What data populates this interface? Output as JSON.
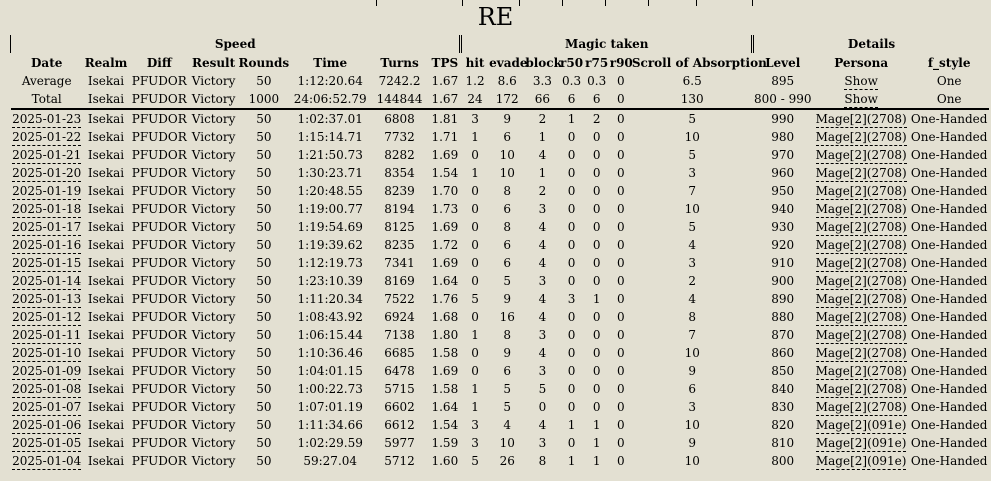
{
  "title": "RE",
  "groups": {
    "speed": "Speed",
    "magic": "Magic taken",
    "details": "Details"
  },
  "columns": [
    "Date",
    "Realm",
    "Diff",
    "Result",
    "Rounds",
    "Time",
    "Turns",
    "TPS",
    "hit",
    "evade",
    "block",
    "r50",
    "r75",
    "r90",
    "Scroll of Absorption",
    "Level",
    "Persona",
    "f_style"
  ],
  "summary": [
    {
      "label": "Average",
      "realm": "Isekai",
      "diff": "PFUDOR",
      "result": "Victory",
      "rounds": "50",
      "time": "1:12:20.64",
      "turns": "7242.2",
      "tps": "1.67",
      "hit": "1.2",
      "evade": "8.6",
      "block": "3.3",
      "r50": "0.3",
      "r75": "0.3",
      "r90": "0",
      "scroll": "6.5",
      "level": "895",
      "persona": "Show",
      "fstyle": "One"
    },
    {
      "label": "Total",
      "realm": "Isekai",
      "diff": "PFUDOR",
      "result": "Victory",
      "rounds": "1000",
      "time": "24:06:52.79",
      "turns": "144844",
      "tps": "1.67",
      "hit": "24",
      "evade": "172",
      "block": "66",
      "r50": "6",
      "r75": "6",
      "r90": "0",
      "scroll": "130",
      "level": "800 - 990",
      "persona": "Show",
      "fstyle": "One"
    }
  ],
  "rows": [
    {
      "date": "2025-01-23",
      "realm": "Isekai",
      "diff": "PFUDOR",
      "result": "Victory",
      "rounds": "50",
      "time": "1:02:37.01",
      "turns": "6808",
      "tps": "1.81",
      "hit": "3",
      "evade": "9",
      "block": "2",
      "r50": "1",
      "r75": "2",
      "r90": "0",
      "scroll": "5",
      "level": "990",
      "persona": "Mage[2](2708)",
      "fstyle": "One-Handed"
    },
    {
      "date": "2025-01-22",
      "realm": "Isekai",
      "diff": "PFUDOR",
      "result": "Victory",
      "rounds": "50",
      "time": "1:15:14.71",
      "turns": "7732",
      "tps": "1.71",
      "hit": "1",
      "evade": "6",
      "block": "1",
      "r50": "0",
      "r75": "0",
      "r90": "0",
      "scroll": "10",
      "level": "980",
      "persona": "Mage[2](2708)",
      "fstyle": "One-Handed"
    },
    {
      "date": "2025-01-21",
      "realm": "Isekai",
      "diff": "PFUDOR",
      "result": "Victory",
      "rounds": "50",
      "time": "1:21:50.73",
      "turns": "8282",
      "tps": "1.69",
      "hit": "0",
      "evade": "10",
      "block": "4",
      "r50": "0",
      "r75": "0",
      "r90": "0",
      "scroll": "5",
      "level": "970",
      "persona": "Mage[2](2708)",
      "fstyle": "One-Handed"
    },
    {
      "date": "2025-01-20",
      "realm": "Isekai",
      "diff": "PFUDOR",
      "result": "Victory",
      "rounds": "50",
      "time": "1:30:23.71",
      "turns": "8354",
      "tps": "1.54",
      "hit": "1",
      "evade": "10",
      "block": "1",
      "r50": "0",
      "r75": "0",
      "r90": "0",
      "scroll": "3",
      "level": "960",
      "persona": "Mage[2](2708)",
      "fstyle": "One-Handed"
    },
    {
      "date": "2025-01-19",
      "realm": "Isekai",
      "diff": "PFUDOR",
      "result": "Victory",
      "rounds": "50",
      "time": "1:20:48.55",
      "turns": "8239",
      "tps": "1.70",
      "hit": "0",
      "evade": "8",
      "block": "2",
      "r50": "0",
      "r75": "0",
      "r90": "0",
      "scroll": "7",
      "level": "950",
      "persona": "Mage[2](2708)",
      "fstyle": "One-Handed"
    },
    {
      "date": "2025-01-18",
      "realm": "Isekai",
      "diff": "PFUDOR",
      "result": "Victory",
      "rounds": "50",
      "time": "1:19:00.77",
      "turns": "8194",
      "tps": "1.73",
      "hit": "0",
      "evade": "6",
      "block": "3",
      "r50": "0",
      "r75": "0",
      "r90": "0",
      "scroll": "10",
      "level": "940",
      "persona": "Mage[2](2708)",
      "fstyle": "One-Handed"
    },
    {
      "date": "2025-01-17",
      "realm": "Isekai",
      "diff": "PFUDOR",
      "result": "Victory",
      "rounds": "50",
      "time": "1:19:54.69",
      "turns": "8125",
      "tps": "1.69",
      "hit": "0",
      "evade": "8",
      "block": "4",
      "r50": "0",
      "r75": "0",
      "r90": "0",
      "scroll": "5",
      "level": "930",
      "persona": "Mage[2](2708)",
      "fstyle": "One-Handed"
    },
    {
      "date": "2025-01-16",
      "realm": "Isekai",
      "diff": "PFUDOR",
      "result": "Victory",
      "rounds": "50",
      "time": "1:19:39.62",
      "turns": "8235",
      "tps": "1.72",
      "hit": "0",
      "evade": "6",
      "block": "4",
      "r50": "0",
      "r75": "0",
      "r90": "0",
      "scroll": "4",
      "level": "920",
      "persona": "Mage[2](2708)",
      "fstyle": "One-Handed"
    },
    {
      "date": "2025-01-15",
      "realm": "Isekai",
      "diff": "PFUDOR",
      "result": "Victory",
      "rounds": "50",
      "time": "1:12:19.73",
      "turns": "7341",
      "tps": "1.69",
      "hit": "0",
      "evade": "6",
      "block": "4",
      "r50": "0",
      "r75": "0",
      "r90": "0",
      "scroll": "3",
      "level": "910",
      "persona": "Mage[2](2708)",
      "fstyle": "One-Handed"
    },
    {
      "date": "2025-01-14",
      "realm": "Isekai",
      "diff": "PFUDOR",
      "result": "Victory",
      "rounds": "50",
      "time": "1:23:10.39",
      "turns": "8169",
      "tps": "1.64",
      "hit": "0",
      "evade": "5",
      "block": "3",
      "r50": "0",
      "r75": "0",
      "r90": "0",
      "scroll": "2",
      "level": "900",
      "persona": "Mage[2](2708)",
      "fstyle": "One-Handed"
    },
    {
      "date": "2025-01-13",
      "realm": "Isekai",
      "diff": "PFUDOR",
      "result": "Victory",
      "rounds": "50",
      "time": "1:11:20.34",
      "turns": "7522",
      "tps": "1.76",
      "hit": "5",
      "evade": "9",
      "block": "4",
      "r50": "3",
      "r75": "1",
      "r90": "0",
      "scroll": "4",
      "level": "890",
      "persona": "Mage[2](2708)",
      "fstyle": "One-Handed"
    },
    {
      "date": "2025-01-12",
      "realm": "Isekai",
      "diff": "PFUDOR",
      "result": "Victory",
      "rounds": "50",
      "time": "1:08:43.92",
      "turns": "6924",
      "tps": "1.68",
      "hit": "0",
      "evade": "16",
      "block": "4",
      "r50": "0",
      "r75": "0",
      "r90": "0",
      "scroll": "8",
      "level": "880",
      "persona": "Mage[2](2708)",
      "fstyle": "One-Handed"
    },
    {
      "date": "2025-01-11",
      "realm": "Isekai",
      "diff": "PFUDOR",
      "result": "Victory",
      "rounds": "50",
      "time": "1:06:15.44",
      "turns": "7138",
      "tps": "1.80",
      "hit": "1",
      "evade": "8",
      "block": "3",
      "r50": "0",
      "r75": "0",
      "r90": "0",
      "scroll": "7",
      "level": "870",
      "persona": "Mage[2](2708)",
      "fstyle": "One-Handed"
    },
    {
      "date": "2025-01-10",
      "realm": "Isekai",
      "diff": "PFUDOR",
      "result": "Victory",
      "rounds": "50",
      "time": "1:10:36.46",
      "turns": "6685",
      "tps": "1.58",
      "hit": "0",
      "evade": "9",
      "block": "4",
      "r50": "0",
      "r75": "0",
      "r90": "0",
      "scroll": "10",
      "level": "860",
      "persona": "Mage[2](2708)",
      "fstyle": "One-Handed"
    },
    {
      "date": "2025-01-09",
      "realm": "Isekai",
      "diff": "PFUDOR",
      "result": "Victory",
      "rounds": "50",
      "time": "1:04:01.15",
      "turns": "6478",
      "tps": "1.69",
      "hit": "0",
      "evade": "6",
      "block": "3",
      "r50": "0",
      "r75": "0",
      "r90": "0",
      "scroll": "9",
      "level": "850",
      "persona": "Mage[2](2708)",
      "fstyle": "One-Handed"
    },
    {
      "date": "2025-01-08",
      "realm": "Isekai",
      "diff": "PFUDOR",
      "result": "Victory",
      "rounds": "50",
      "time": "1:00:22.73",
      "turns": "5715",
      "tps": "1.58",
      "hit": "1",
      "evade": "5",
      "block": "5",
      "r50": "0",
      "r75": "0",
      "r90": "0",
      "scroll": "6",
      "level": "840",
      "persona": "Mage[2](2708)",
      "fstyle": "One-Handed"
    },
    {
      "date": "2025-01-07",
      "realm": "Isekai",
      "diff": "PFUDOR",
      "result": "Victory",
      "rounds": "50",
      "time": "1:07:01.19",
      "turns": "6602",
      "tps": "1.64",
      "hit": "1",
      "evade": "5",
      "block": "0",
      "r50": "0",
      "r75": "0",
      "r90": "0",
      "scroll": "3",
      "level": "830",
      "persona": "Mage[2](2708)",
      "fstyle": "One-Handed"
    },
    {
      "date": "2025-01-06",
      "realm": "Isekai",
      "diff": "PFUDOR",
      "result": "Victory",
      "rounds": "50",
      "time": "1:11:34.66",
      "turns": "6612",
      "tps": "1.54",
      "hit": "3",
      "evade": "4",
      "block": "4",
      "r50": "1",
      "r75": "1",
      "r90": "0",
      "scroll": "10",
      "level": "820",
      "persona": "Mage[2](091e)",
      "fstyle": "One-Handed"
    },
    {
      "date": "2025-01-05",
      "realm": "Isekai",
      "diff": "PFUDOR",
      "result": "Victory",
      "rounds": "50",
      "time": "1:02:29.59",
      "turns": "5977",
      "tps": "1.59",
      "hit": "3",
      "evade": "10",
      "block": "3",
      "r50": "0",
      "r75": "1",
      "r90": "0",
      "scroll": "9",
      "level": "810",
      "persona": "Mage[2](091e)",
      "fstyle": "One-Handed"
    },
    {
      "date": "2025-01-04",
      "realm": "Isekai",
      "diff": "PFUDOR",
      "result": "Victory",
      "rounds": "50",
      "time": "59:27.04",
      "turns": "5712",
      "tps": "1.60",
      "hit": "5",
      "evade": "26",
      "block": "8",
      "r50": "1",
      "r75": "1",
      "r90": "0",
      "scroll": "10",
      "level": "800",
      "persona": "Mage[2](091e)",
      "fstyle": "One-Handed"
    }
  ]
}
